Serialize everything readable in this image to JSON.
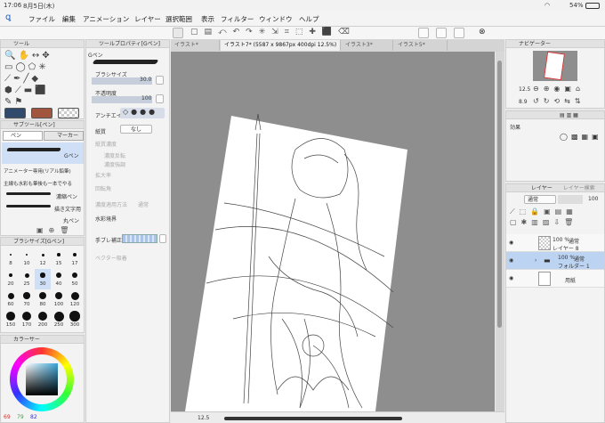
{
  "status": {
    "time": "17:06",
    "date": "8月5日(木)",
    "battery": "54%"
  },
  "menu": [
    "ファイル",
    "編集",
    "アニメーション",
    "レイヤー",
    "選択範囲",
    "表示",
    "フィルター",
    "ウィンドウ",
    "ヘルプ"
  ],
  "tabs": [
    "イラスト*",
    "イラスト7* (5587 x 9867px 400dpi 12.5%)",
    "イラスト3*",
    "イラスト5*"
  ],
  "tool_panel": {
    "title": "ツール"
  },
  "subtool": {
    "title": "サブツール[ペン]",
    "tab1": "ペン",
    "tab2": "マーカー",
    "items": [
      "Gペン",
      "アニメーター専用(リアル鉛筆)",
      "主線も水彩も筆後も一本でやる",
      "濃縮ペン",
      "描き文字用",
      "丸ペン"
    ]
  },
  "brushsize_panel": {
    "title": "ブラシサイズ[Gペン]",
    "sizes": [
      "8",
      "10",
      "12",
      "15",
      "17",
      "20",
      "25",
      "30",
      "40",
      "50",
      "60",
      "70",
      "80",
      "100",
      "120",
      "150",
      "170",
      "200",
      "250",
      "300"
    ]
  },
  "color_panel": {
    "title": "カラーサー",
    "r": "69",
    "g": "79",
    "b": "82"
  },
  "toolprop": {
    "title": "ツールプロパティ[Gペン]",
    "tool_name": "Gペン",
    "brush_size_label": "ブラシサイズ",
    "brush_size_value": "30.0",
    "opacity_label": "不透明度",
    "opacity_value": "100",
    "aa_label": "アンチエイ",
    "pressure_label": "紙質",
    "pressure_value": "なし",
    "texture_label": "紙質濃度",
    "opt1": "濃度反転",
    "opt2": "濃度強調",
    "scale_label": "拡大率",
    "rotate_label": "回転角",
    "apply_label": "濃度適用方法",
    "apply_value": "通常",
    "watercolor_label": "水彩境界",
    "stabilize_label": "手ブレ補正",
    "vector_label": "ベクター吸着"
  },
  "navigator": {
    "title": "ナビゲーター",
    "zoom": "12.5",
    "rotate": "8.9"
  },
  "effect_panel": {
    "label": "効果"
  },
  "layers": {
    "tab1": "レイヤー",
    "tab2": "レイヤー検索",
    "blend": "通常",
    "opacity": "100",
    "items": [
      {
        "pct": "100 %",
        "mode": "通常",
        "name": "レイヤー 8"
      },
      {
        "pct": "100 %",
        "mode": "通常",
        "name": "フォルダー 1"
      },
      {
        "pct": "",
        "mode": "",
        "name": "用紙"
      }
    ]
  },
  "bottom": {
    "zoom": "12.5"
  },
  "colors": {
    "accent": "#4a7fd6",
    "swatch1": "#2f4a6a",
    "swatch2": "#a0553c"
  }
}
